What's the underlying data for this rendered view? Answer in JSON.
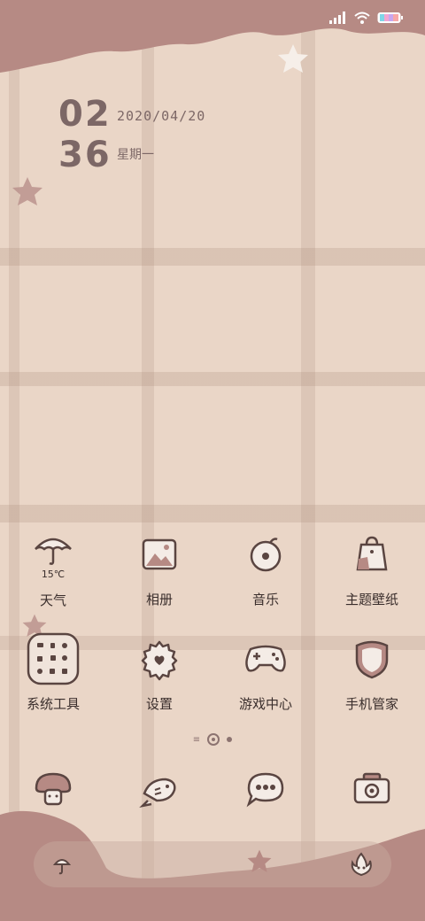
{
  "status_bar": {
    "icons": [
      "signal-icon",
      "wifi-icon",
      "battery-icon"
    ]
  },
  "clock": {
    "hour": "02",
    "minute": "36",
    "date": "2020/04/20",
    "weekday": "星期一"
  },
  "weather": {
    "temperature": "15℃"
  },
  "apps": [
    {
      "label": "天气",
      "icon": "umbrella-icon"
    },
    {
      "label": "相册",
      "icon": "photo-frame-icon"
    },
    {
      "label": "音乐",
      "icon": "music-disc-icon"
    },
    {
      "label": "主题壁纸",
      "icon": "bag-icon"
    },
    {
      "label": "系统工具",
      "icon": "tools-folder-icon"
    },
    {
      "label": "设置",
      "icon": "gear-icon"
    },
    {
      "label": "游戏中心",
      "icon": "gamepad-icon"
    },
    {
      "label": "手机管家",
      "icon": "shield-icon"
    }
  ],
  "page_indicator": {
    "pages": 2,
    "current": 1
  },
  "dock": [
    {
      "icon": "phone-mushroom-icon"
    },
    {
      "icon": "fish-contacts-icon"
    },
    {
      "icon": "message-bubble-icon"
    },
    {
      "icon": "camera-icon"
    }
  ],
  "colors": {
    "background": "#ead6c7",
    "wave": "#b68a84",
    "icon_stroke": "#5a4541",
    "text": "#3a2e2c"
  }
}
